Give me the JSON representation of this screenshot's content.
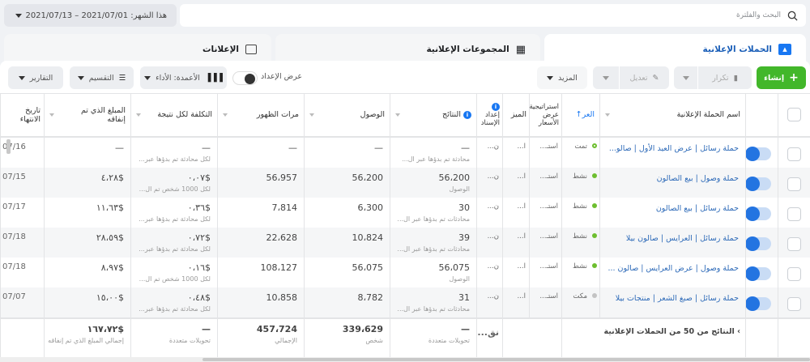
{
  "search": {
    "placeholder": "البحث والفلترة"
  },
  "date_range": {
    "label": "هذا الشهر: 2021/07/01 – 2021/07/13"
  },
  "tabs": [
    {
      "label": "الحملات الإعلانية",
      "active": true
    },
    {
      "label": "المجموعات الإعلانية"
    },
    {
      "label": "الإعلانات"
    }
  ],
  "toolbar": {
    "create": "إنشاء",
    "duplicate": "تكرار",
    "edit": "تعديل",
    "more": "المزيد",
    "view_setup": "عرض الإعداد",
    "columns": "الأعمدة: الأداء",
    "breakdown": "التقسيم",
    "reports": "التقارير"
  },
  "colors": {
    "accent": "#1877f2",
    "create_green": "#42b72a",
    "active_dot": "#6dbe2f"
  },
  "table": {
    "headers": {
      "name": "اسم الحملة الإعلانية",
      "delivery": "العر",
      "bid": "استراتيجية عرض الأسعار",
      "budget": "الميز",
      "attribution": "إعداد الإسناد",
      "results": "النتائج",
      "reach": "الوصول",
      "impressions": "مرات الظهور",
      "cost": "التكلفة لكل نتيجة",
      "spent": "المبلغ الذي تم إنفاقه",
      "end": "تاريخ الانتهاء"
    },
    "rows": [
      {
        "name": "حملة رسائل | عرض العيد الأول | صالو...",
        "delivery": "تمت",
        "status": "completed",
        "bid": "استـ...",
        "budget": "ا...",
        "attribution": "ن...",
        "results": "—",
        "results_sub": "محادثة تم بدؤها عبر ال...",
        "reach": "—",
        "impressions": "—",
        "cost": "—",
        "cost_sub": "لكل محادثة تم بدؤها عبر...",
        "spent": "—",
        "end": "07/16"
      },
      {
        "name": "حملة وصول | بيع الصالون",
        "delivery": "نشط",
        "status": "active",
        "bid": "استـ...",
        "budget": "ا...",
        "attribution": "ن...",
        "results": "56،200",
        "results_sub": "الوصول",
        "reach": "56،200",
        "impressions": "56،957",
        "cost": "٠،٠٧$",
        "cost_sub": "لكل 1000 شخص تم ال...",
        "spent": "٤،٢٨$",
        "end": "07/15"
      },
      {
        "name": "حملة رسائل | بيع الصالون",
        "delivery": "نشط",
        "status": "active",
        "bid": "استـ...",
        "budget": "ا...",
        "attribution": "ن...",
        "results": "30",
        "results_sub": "محادثات تم بدؤها عبر ال...",
        "reach": "6،300",
        "impressions": "7،814",
        "cost": "٠،٣٦$",
        "cost_sub": "لكل محادثة تم بدؤها عبر...",
        "spent": "١١،٦٣$",
        "end": "07/17"
      },
      {
        "name": "حملة رسائل | العرايس | صالون بيلا",
        "delivery": "نشط",
        "status": "active",
        "bid": "استـ...",
        "budget": "ا...",
        "attribution": "ن...",
        "results": "39",
        "results_sub": "محادثات تم بدؤها عبر ال...",
        "reach": "10،824",
        "impressions": "22،628",
        "cost": "٠،٧٢$",
        "cost_sub": "لكل محادثة تم بدؤها عبر...",
        "spent": "٢٨،٥٩$",
        "end": "07/18"
      },
      {
        "name": "حملة وصول | عرض العرايس | صالون ...",
        "delivery": "نشط",
        "status": "active",
        "bid": "استـ...",
        "budget": "ا...",
        "attribution": "ن...",
        "results": "56،075",
        "results_sub": "الوصول",
        "reach": "56،075",
        "impressions": "108،127",
        "cost": "٠،١٦$",
        "cost_sub": "لكل 1000 شخص تم ال...",
        "spent": "٨،٩٧$",
        "end": "07/18"
      },
      {
        "name": "حملة رسائل | صبغ الشعر | منتجات بيلا",
        "delivery": "مكت",
        "status": "off",
        "bid": "استـ...",
        "budget": "ا...",
        "attribution": "ن...",
        "results": "31",
        "results_sub": "محادثات تم بدؤها عبر ال...",
        "reach": "8،782",
        "impressions": "10،858",
        "cost": "٠،٤٨$",
        "cost_sub": "لكل محادثة تم بدؤها عبر...",
        "spent": "١٥،٠٠$",
        "end": "07/07"
      }
    ],
    "footer": {
      "label": "النتائج من 50 من الحملات الإعلانية",
      "attribution": "نق...",
      "results": "—",
      "results_sub": "تحويلات متعددة",
      "reach": "339،629",
      "reach_sub": "شخص",
      "impressions": "457،724",
      "impressions_sub": "الإجمالي",
      "cost": "—",
      "cost_sub": "تحويلات متعددة",
      "spent": "١٦٧،٧٢$",
      "spent_sub": "إجمالي المبلغ الذي تم إنفاقه"
    }
  }
}
